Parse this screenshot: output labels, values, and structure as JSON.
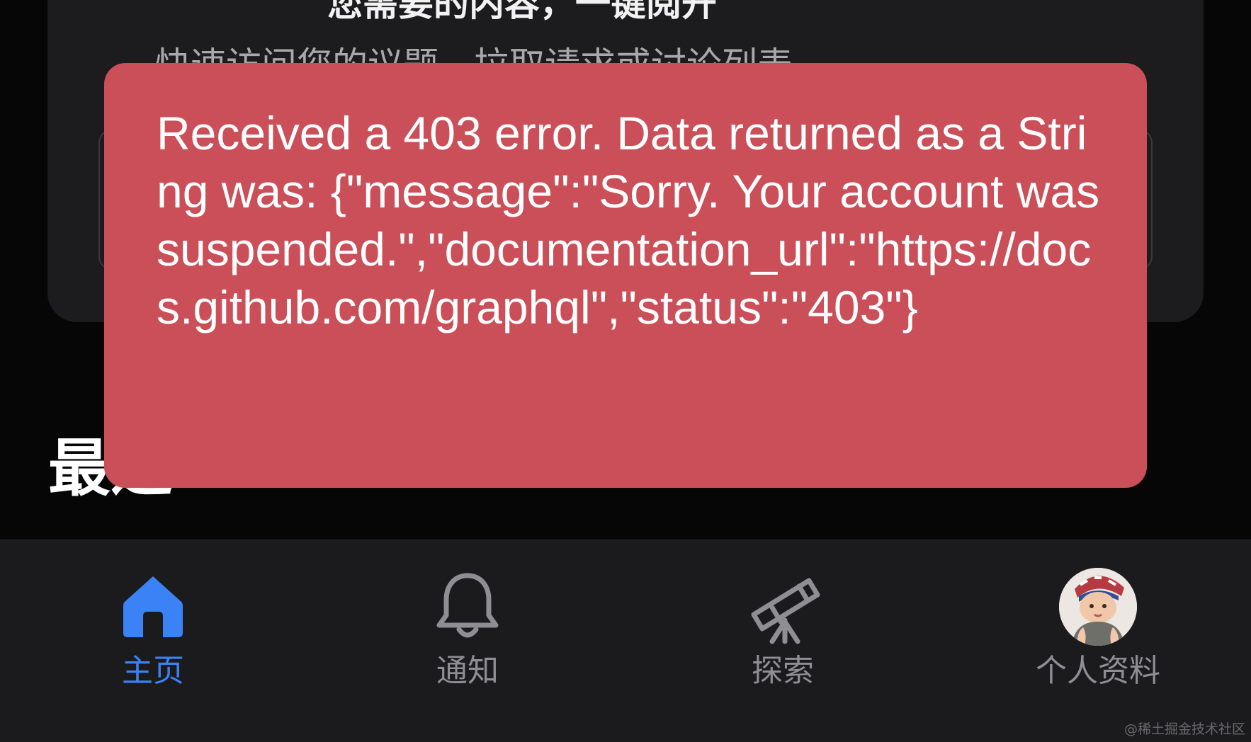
{
  "background_card": {
    "title": "您需要的内容，一键阅开",
    "subtitle": "快速访问您的议题、拉取请求或讨论列表"
  },
  "section": {
    "heading": "最近"
  },
  "toast": {
    "message": "Received a 403 error. Data returned as a String was: {\"message\":\"Sorry. Your account was suspended.\",\"documentation_url\":\"https://docs.github.com/graphql\",\"status\":\"403\"}",
    "background_color": "#cb4f58"
  },
  "tab_bar": {
    "active_color": "#3b82f6",
    "inactive_color": "#8e8e93",
    "tabs": [
      {
        "label": "主页",
        "icon": "home-icon",
        "active": true
      },
      {
        "label": "通知",
        "icon": "bell-icon",
        "active": false
      },
      {
        "label": "探索",
        "icon": "telescope-icon",
        "active": false
      },
      {
        "label": "个人资料",
        "icon": "avatar",
        "active": false
      }
    ]
  },
  "watermark": "@稀土掘金技术社区"
}
